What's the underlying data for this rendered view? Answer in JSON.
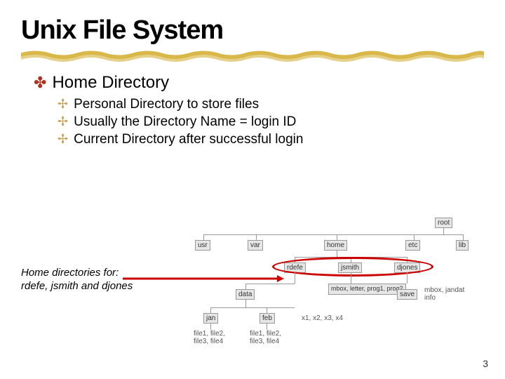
{
  "title": "Unix File System",
  "bullet_main": "Home Directory",
  "sub_bullets": [
    "Personal Directory to store files",
    "Usually the Directory Name = login ID",
    "Current Directory after successful login"
  ],
  "caption": "Home directories for: rdefe, jsmith and djones",
  "page_number": "3",
  "tree": {
    "root": "root",
    "level1": [
      "usr",
      "var",
      "home",
      "etc",
      "lib"
    ],
    "home_children": [
      "rdefe",
      "jsmith",
      "djones"
    ],
    "rdefe_children": [
      "data"
    ],
    "jsmith_children": "mbox, letter, prog1, prog2",
    "djones_children": [
      "save"
    ],
    "djones_label": "mbox, jandat info",
    "data_children": [
      "jan",
      "feb"
    ],
    "data_label": "x1, x2, x3, x4",
    "jan_label": "file1, file2, file3, file4",
    "feb_label": "file1, file2, file3, file4"
  }
}
